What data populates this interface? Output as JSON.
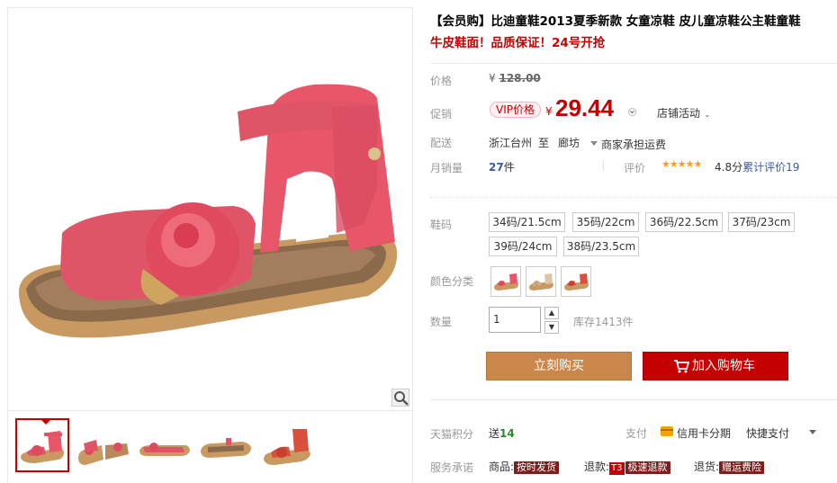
{
  "product": {
    "title": "【会员购】比迪童鞋2013夏季新款 女童凉鞋 皮儿童凉鞋公主鞋童鞋",
    "subtitle": "牛皮鞋面！品质保证！24号开抢"
  },
  "price": {
    "label": "价格",
    "currency": "¥",
    "original": "128.00"
  },
  "promo": {
    "label": "促销",
    "vip_tag": "VIP价格",
    "currency": "¥",
    "sale_price": "29.44",
    "shop_activity": "店铺活动"
  },
  "shipping": {
    "label": "配送",
    "from": "浙江台州",
    "to_word": "至",
    "destination": "廊坊",
    "fee": "商家承担运费"
  },
  "sales": {
    "label": "月销量",
    "count": "27",
    "unit": "件",
    "review_label": "评价",
    "stars": "★★★★★",
    "score": "4.8分",
    "review_link": "累计评价19"
  },
  "size": {
    "label": "鞋码",
    "options": [
      "34码/21.5cm",
      "35码/22cm",
      "36码/22.5cm",
      "37码/23cm",
      "39码/24cm",
      "38码/23.5cm"
    ]
  },
  "color": {
    "label": "颜色分类",
    "swatches": [
      "pink",
      "beige",
      "red"
    ]
  },
  "quantity": {
    "label": "数量",
    "value": "1",
    "stock": "库存1413件"
  },
  "actions": {
    "buy_now": "立刻购买",
    "add_to_cart": "加入购物车"
  },
  "points": {
    "label": "天猫积分",
    "text": "送",
    "value": "14",
    "pay_label": "支付",
    "installment": "信用卡分期",
    "quick_pay": "快捷支付"
  },
  "service": {
    "label": "服务承诺",
    "goods_label": "商品:",
    "goods_badge": "按时发货",
    "refund_label": "退款:",
    "refund_tag": "T3",
    "refund_badge": "极速退款",
    "return_label": "退货:",
    "return_badge": "赠运费险"
  },
  "colors": {
    "accent_red": "#c40000",
    "buy_orange": "#c9874b",
    "link_blue": "#3c5a9a",
    "star_gold": "#f5a300"
  }
}
